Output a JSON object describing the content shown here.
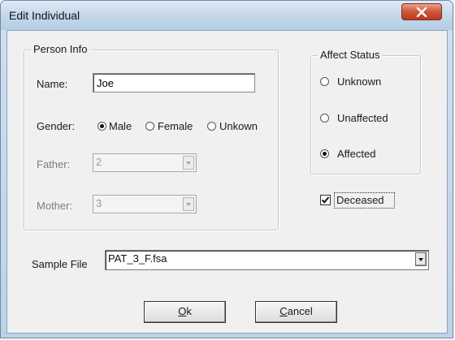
{
  "window": {
    "title": "Edit Individual"
  },
  "person_info": {
    "legend": "Person Info",
    "name_label": "Name:",
    "name_value": "Joe",
    "gender_label": "Gender:",
    "gender_options": [
      "Male",
      "Female",
      "Unkown"
    ],
    "gender_selected": "Male",
    "father_label": "Father:",
    "father_value": "2",
    "mother_label": "Mother:",
    "mother_value": "3"
  },
  "affect_status": {
    "legend": "Affect Status",
    "options": [
      "Unknown",
      "Unaffected",
      "Affected"
    ],
    "selected": "Affected"
  },
  "deceased": {
    "label": "Deceased",
    "checked": true
  },
  "sample_file": {
    "label": "Sample File",
    "value": "PAT_3_F.fsa"
  },
  "buttons": {
    "ok_prefix": "O",
    "ok_rest": "k",
    "cancel_prefix": "C",
    "cancel_rest": "ancel"
  },
  "icons": {
    "close": "close-x-icon",
    "check": "checkmark-icon",
    "dropdown": "chevron-down-icon"
  },
  "colors": {
    "close_button": "#c9452b",
    "frame": "#bcd3e7"
  }
}
